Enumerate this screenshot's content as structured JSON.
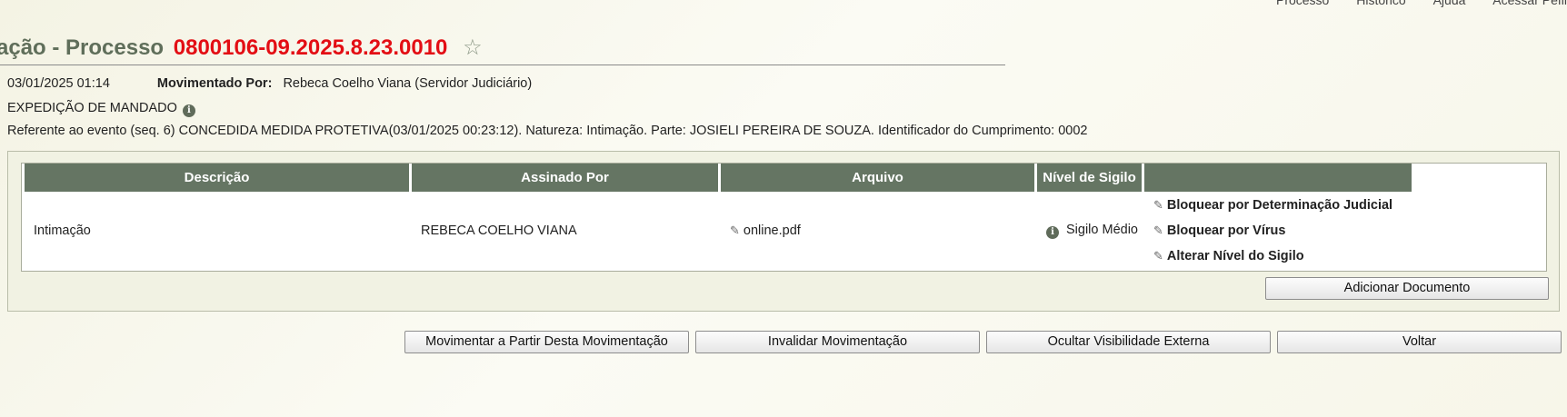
{
  "top_nav": [
    "Processo",
    "Histórico",
    "Ajuda",
    "Acessar Pefil"
  ],
  "header": {
    "title_prefix": "ação - Processo",
    "process_number": "0800106-09.2025.8.23.0010"
  },
  "movement": {
    "datetime": "03/01/2025 01:14",
    "moved_by_label": "Movimentado Por:",
    "moved_by": "Rebeca Coelho Viana (Servidor Judiciário)",
    "type": "EXPEDIÇÃO DE MANDADO",
    "reference": "Referente ao evento (seq. 6) CONCEDIDA MEDIDA PROTETIVA(03/01/2025 00:23:12). Natureza: Intimação. Parte: JOSIELI PEREIRA DE SOUZA. Identificador do Cumprimento: 0002"
  },
  "table": {
    "headers": [
      "Descrição",
      "Assinado Por",
      "Arquivo",
      "Nível de Sigilo",
      ""
    ],
    "rows": [
      {
        "descricao": "Intimação",
        "assinado_por": "REBECA COELHO VIANA",
        "arquivo": "online.pdf",
        "sigilo": "Sigilo Médio",
        "actions": [
          "Bloquear por Determinação Judicial",
          "Bloquear por Vírus",
          "Alterar Nível do Sigilo"
        ]
      }
    ]
  },
  "buttons": {
    "add_document": "Adicionar Documento",
    "move_from": "Movimentar a Partir Desta Movimentação",
    "invalidate": "Invalidar Movimentação",
    "hide_external": "Ocultar Visibilidade Externa",
    "back": "Voltar"
  },
  "colors": {
    "header_text": "#5f6e5a",
    "process_number": "#e30e14",
    "table_header_bg": "#657563"
  }
}
